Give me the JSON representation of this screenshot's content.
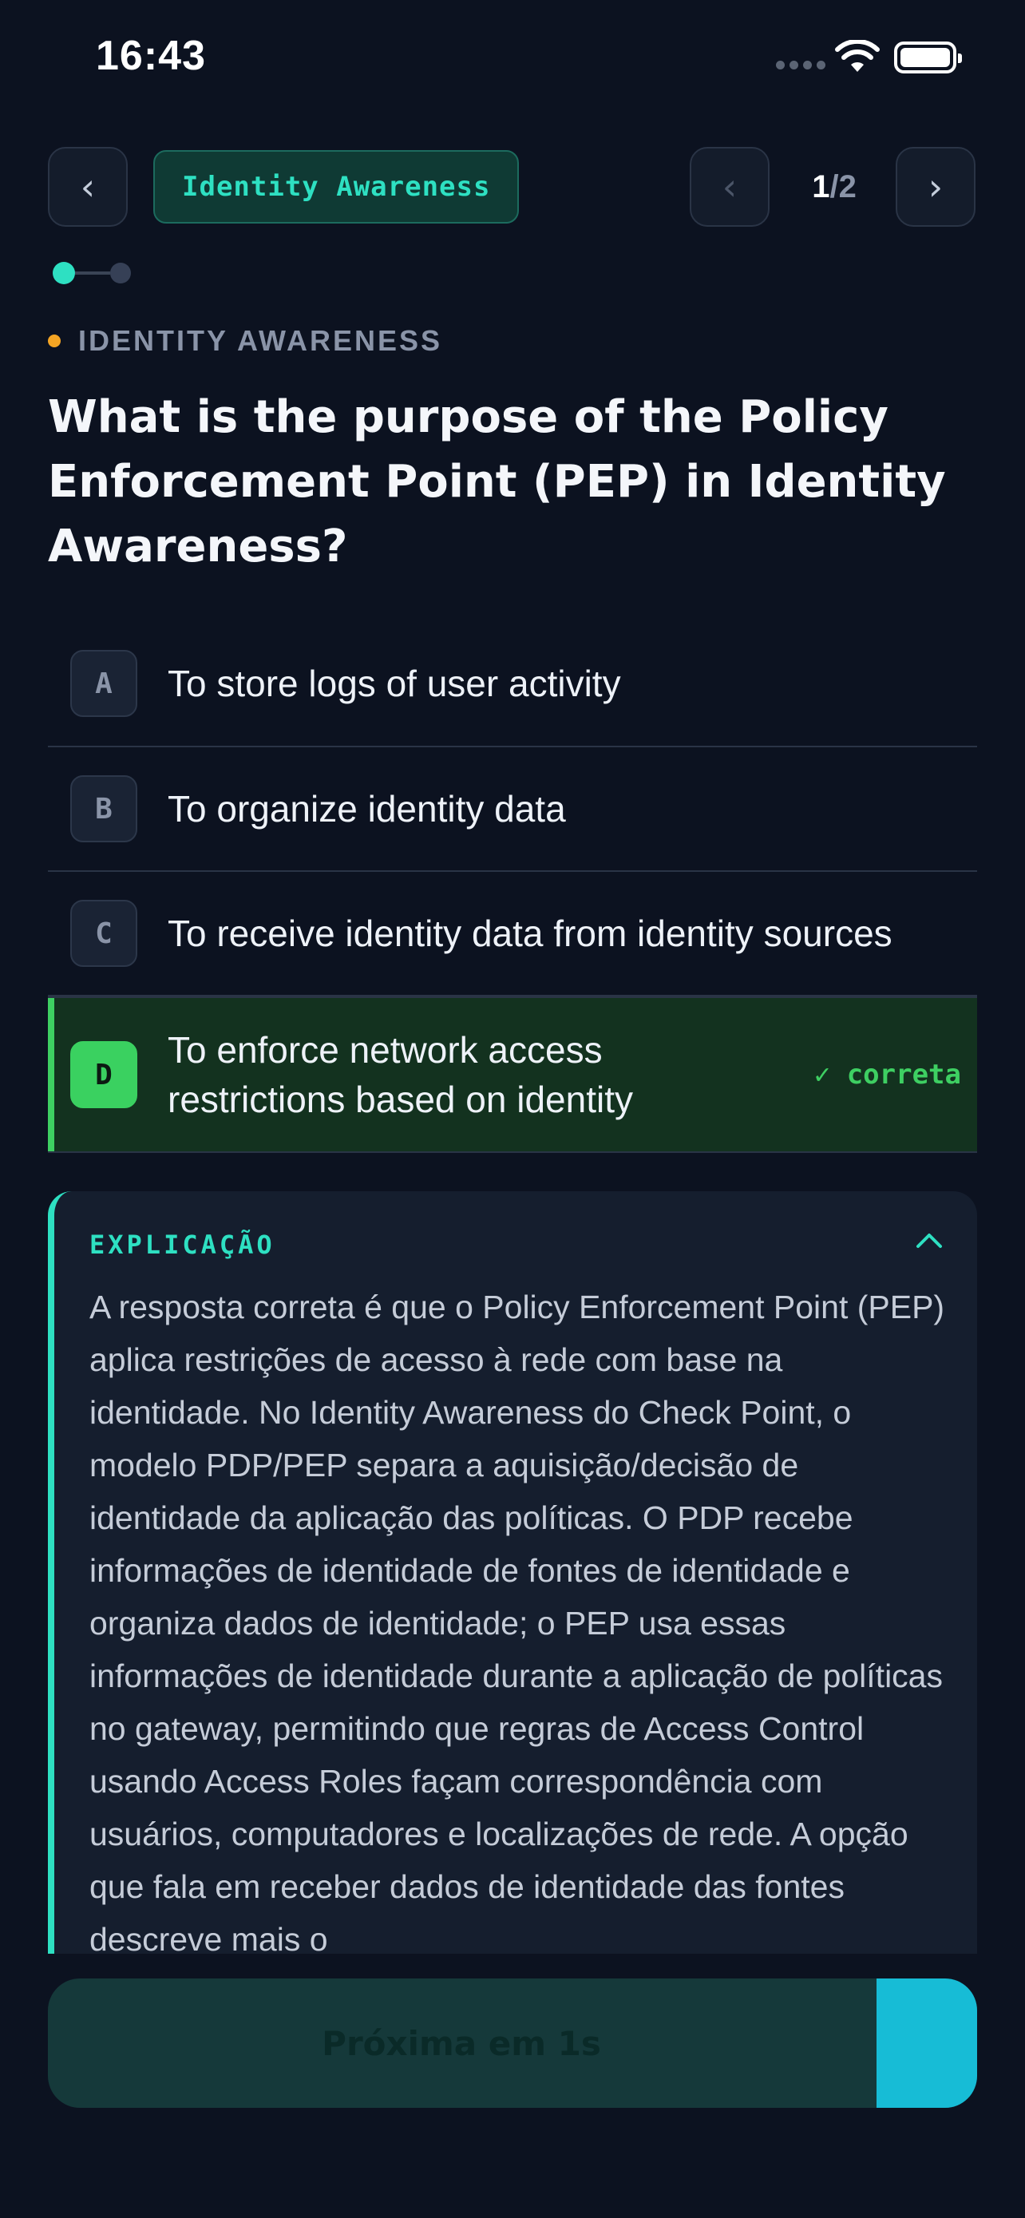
{
  "status_bar": {
    "time": "16:43"
  },
  "header": {
    "back_icon": "‹",
    "category_chip": "Identity Awareness",
    "prev_icon": "‹",
    "next_icon": "›",
    "page_current": "1",
    "page_separator": "/",
    "page_total": "2"
  },
  "progress": {
    "current_step": 1,
    "total_steps": 2
  },
  "category_label": "IDENTITY AWARENESS",
  "question": "What is the purpose of the Policy Enforcement Point (PEP) in Identity Awareness?",
  "options": [
    {
      "letter": "A",
      "text": "To store logs of user activity"
    },
    {
      "letter": "B",
      "text": "To organize identity data"
    },
    {
      "letter": "C",
      "text": "To receive identity data from identity sources"
    },
    {
      "letter": "D",
      "text": "To enforce network access restrictions based on identity",
      "status": "✓ correta"
    }
  ],
  "explanation": {
    "title": "EXPLICAÇÃO",
    "body": "A resposta correta é que o Policy Enforcement Point (PEP) aplica restrições de acesso à rede com base na identidade. No Identity Awareness do Check Point, o modelo PDP/PEP separa a aquisição/decisão de identidade da aplicação das políticas. O PDP recebe informações de identidade de fontes de identidade e organiza dados de identidade; o PEP usa essas informações de identidade durante a aplicação de políticas no gateway, permitindo que regras de Access Control usando Access Roles façam correspondência com usuários, computadores e localizações de rede. A opção que fala em receber dados de identidade das fontes descreve mais o"
  },
  "next_button": {
    "label": "Próxima em 1s"
  },
  "colors": {
    "background": "#0c1220",
    "accent_teal": "#2ee0c2",
    "correct_green": "#3ecf62",
    "category_dot": "#f5a524",
    "cta_progress": "#17bcd6"
  }
}
